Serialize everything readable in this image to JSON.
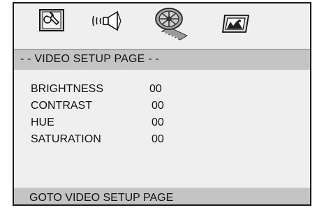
{
  "tabs": [
    {
      "name": "general-setup",
      "icon": "wrench-monitor-icon"
    },
    {
      "name": "audio-setup",
      "icon": "speaker-icon"
    },
    {
      "name": "video-setup",
      "icon": "film-reel-icon",
      "selected": true
    },
    {
      "name": "preference",
      "icon": "picture-monitor-icon"
    }
  ],
  "page": {
    "title": "- - VIDEO SETUP PAGE - -"
  },
  "settings": [
    {
      "label": "BRIGHTNESS",
      "value": "00"
    },
    {
      "label": "CONTRAST",
      "value": "00"
    },
    {
      "label": "HUE",
      "value": "00"
    },
    {
      "label": "SATURATION",
      "value": "00"
    }
  ],
  "status": {
    "text": "GOTO VIDEO SETUP PAGE"
  },
  "colors": {
    "screen_bg": "#efefef",
    "bar_bg": "#c4c4c4",
    "text": "#111111"
  }
}
